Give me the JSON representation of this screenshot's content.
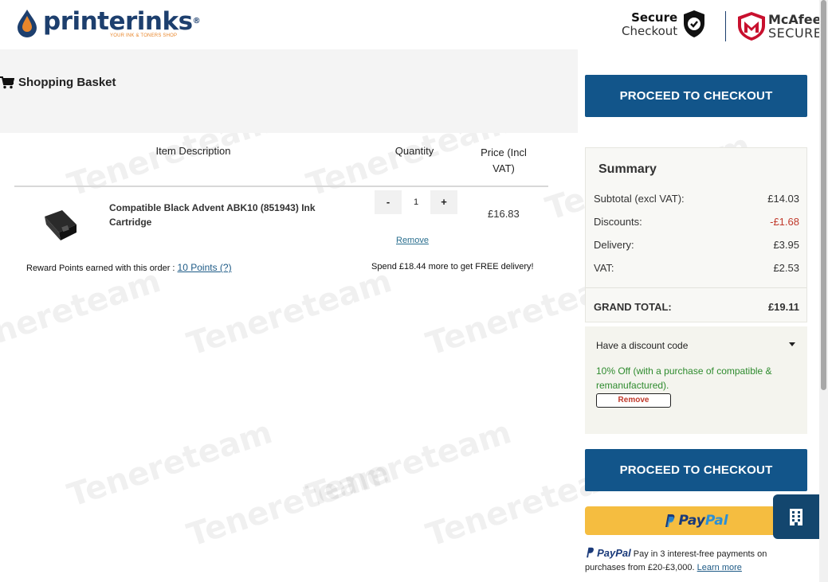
{
  "header": {
    "logo_name": "printerinks",
    "logo_reg": "®",
    "logo_tagline": "YOUR INK & TONERS SHOP",
    "secure_line1": "Secure",
    "secure_line2": "Checkout",
    "mcafee_line1": "McAfee",
    "mcafee_line2": "SECURE"
  },
  "basket": {
    "title": "Shopping Basket",
    "columns": [
      "Item Description",
      "Quantity",
      "Price (Incl VAT)"
    ],
    "item": {
      "name": "Compatible Black Advent ABK10 (851943) Ink Cartridge",
      "qty_minus": "-",
      "quantity": "1",
      "qty_plus": "+",
      "remove_label": "Remove",
      "price": "£16.83"
    },
    "reward_text": "Reward Points earned with this order : ",
    "reward_link": "10 Points (?)",
    "spend_text": "Spend £18.44 more to get FREE delivery!"
  },
  "checkout": {
    "label": "PROCEED TO CHECKOUT"
  },
  "summary": {
    "title": "Summary",
    "subtotal_label": "Subtotal (excl VAT):",
    "subtotal_value": "£14.03",
    "discounts_label": "Discounts:",
    "discounts_value": "-£1.68",
    "delivery_label": "Delivery:",
    "delivery_value": "£3.95",
    "vat_label": "VAT:",
    "vat_value": "£2.53",
    "grand_label": "GRAND TOTAL:",
    "grand_value": "£19.11"
  },
  "discount": {
    "heading": "Have a discount code",
    "message": "10% Off (with a purchase of compatible & remanufactured).",
    "remove_label": "Remove"
  },
  "paypal": {
    "word_part1": "Pay",
    "word_part2": "Pal",
    "paylater_brand": "PayPal",
    "paylater_text": "Pay in 3 interest-free payments on purchases from £20-£3,000.",
    "learn_more": "Learn more"
  },
  "colors": {
    "brand_navy": "#1d3f6e",
    "checkout_blue": "#12558a",
    "paypal_yellow": "#f5bd40",
    "discount_red": "#c0392b",
    "success_green": "#2e8b2e"
  },
  "watermark_text": "Tenereteam"
}
